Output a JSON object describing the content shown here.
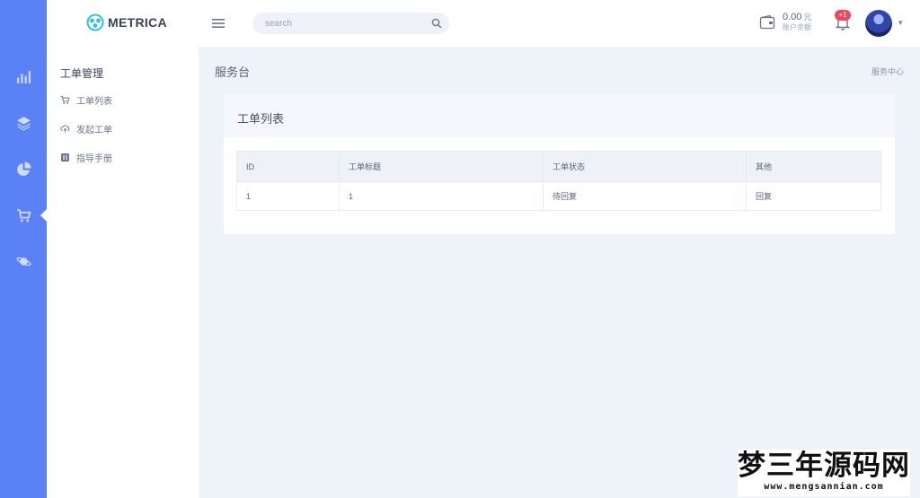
{
  "app": {
    "brand": "METRICA"
  },
  "search": {
    "placeholder": "search"
  },
  "wallet": {
    "amount": "0.00",
    "currency": "元",
    "label": "账户余额"
  },
  "notifications": {
    "badge": "+1"
  },
  "rail": {
    "items": [
      "chart-icon",
      "layers-icon",
      "pie-icon",
      "cart-icon",
      "planet-icon"
    ],
    "active": "cart-icon"
  },
  "subnav": {
    "title": "工单管理",
    "items": [
      {
        "label": "工单列表",
        "icon": "cart-icon"
      },
      {
        "label": "发起工单",
        "icon": "cloud-upload-icon"
      },
      {
        "label": "指导手册",
        "icon": "book-icon"
      }
    ]
  },
  "page": {
    "title": "服务台",
    "breadcrumb": "服务中心"
  },
  "card": {
    "title": "工单列表"
  },
  "table": {
    "headers": [
      "ID",
      "工单标题",
      "工单状态",
      "其他"
    ],
    "rows": [
      [
        "1",
        "1",
        "待回复",
        "回复"
      ]
    ]
  },
  "watermark": {
    "main": "梦三年源码网",
    "sub": "www.mengsannian.com"
  },
  "colors": {
    "rail": "#5a82f6",
    "background": "#eef2f9",
    "badge": "#f0465b"
  }
}
